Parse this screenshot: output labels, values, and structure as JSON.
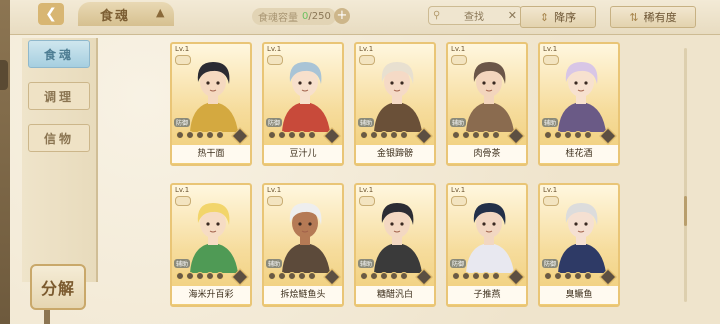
{
  "header": {
    "title": "食魂",
    "capacity_label": "食魂容量",
    "capacity_current": "0",
    "capacity_max": "/250",
    "search_placeholder": "查找",
    "sort_order_label": "降序",
    "sort_rarity_label": "稀有度"
  },
  "sidebar": {
    "items": [
      {
        "label": "食魂",
        "active": true
      },
      {
        "label": "调理",
        "active": false
      },
      {
        "label": "信物",
        "active": false
      }
    ],
    "decompose_label": "分解"
  },
  "cards": [
    {
      "level": "Lv.1",
      "name": "热干面",
      "tag": "防御"
    },
    {
      "level": "Lv.1",
      "name": "豆汁儿",
      "tag": "防御"
    },
    {
      "level": "Lv.1",
      "name": "金银蹄髈",
      "tag": "辅助"
    },
    {
      "level": "Lv.1",
      "name": "肉骨茶",
      "tag": "辅助"
    },
    {
      "level": "Lv.1",
      "name": "桂花酒",
      "tag": "辅助"
    },
    {
      "level": "Lv.1",
      "name": "海米升百彩",
      "tag": "辅助"
    },
    {
      "level": "Lv.1",
      "name": "拆烩鲢鱼头",
      "tag": "辅助"
    },
    {
      "level": "Lv.1",
      "name": "糖醋汎白",
      "tag": "辅助"
    },
    {
      "level": "Lv.1",
      "name": "子推燕",
      "tag": "防御"
    },
    {
      "level": "Lv.1",
      "name": "臭鳜鱼",
      "tag": "防御"
    }
  ],
  "colors": {
    "accent": "#d8b673",
    "card_gold": "#f0cd77",
    "active_tab": "#a6cfe0",
    "text_dark": "#3d2f1c"
  }
}
